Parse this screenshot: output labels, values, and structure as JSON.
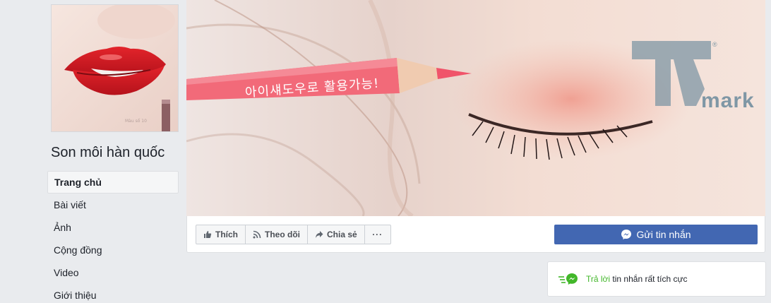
{
  "page": {
    "name": "Son môi hàn quốc"
  },
  "sidebar": {
    "items": [
      {
        "label": "Trang chủ",
        "active": true
      },
      {
        "label": "Bài viết"
      },
      {
        "label": "Ảnh"
      },
      {
        "label": "Cộng đồng"
      },
      {
        "label": "Video"
      },
      {
        "label": "Giới thiệu"
      }
    ]
  },
  "cover": {
    "pencil_text": "아이섀도우로 활용가능!",
    "watermark": "mark",
    "watermark_registered": "®"
  },
  "actions": {
    "like_label": "Thích",
    "follow_label": "Theo dõi",
    "share_label": "Chia sẻ",
    "more_label": "···",
    "send_message_label": "Gửi tin nhắn"
  },
  "response": {
    "highlight": "Trả lời",
    "text": " tin nhắn rất tích cực"
  },
  "colors": {
    "brand_blue": "#4267b2",
    "messenger_green": "#42b72a",
    "pencil_pink": "#f26a79"
  }
}
